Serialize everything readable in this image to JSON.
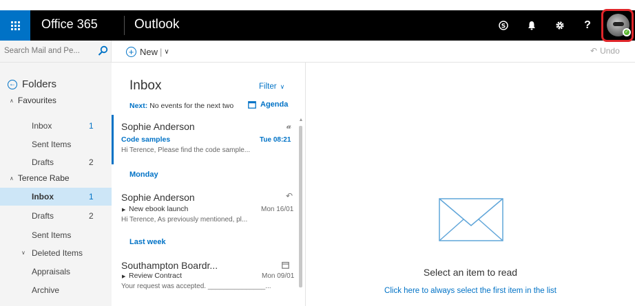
{
  "topbar": {
    "brand": "Office 365",
    "app": "Outlook",
    "icons": [
      "skype-icon",
      "bell-icon",
      "gear-icon",
      "help-icon"
    ],
    "help_label": "?"
  },
  "command": {
    "search_placeholder": "Search Mail and Pe...",
    "new_label": "New",
    "undo_label": "Undo"
  },
  "folders": {
    "heading": "Folders",
    "favourites": {
      "label": "Favourites",
      "items": [
        {
          "label": "Inbox",
          "count": "1"
        },
        {
          "label": "Sent Items",
          "count": ""
        },
        {
          "label": "Drafts",
          "count": "2"
        }
      ]
    },
    "account": {
      "label": "Terence Rabe",
      "items": [
        {
          "label": "Inbox",
          "count": "1"
        },
        {
          "label": "Drafts",
          "count": "2"
        },
        {
          "label": "Sent Items",
          "count": ""
        },
        {
          "label": "Deleted Items",
          "count": ""
        },
        {
          "label": "Appraisals",
          "count": ""
        },
        {
          "label": "Archive",
          "count": ""
        }
      ]
    }
  },
  "list": {
    "title": "Inbox",
    "filter_label": "Filter",
    "next_label": "Next:",
    "next_text": "No events for the next two",
    "agenda_label": "Agenda",
    "groups": [
      "Monday",
      "Last week"
    ],
    "messages": [
      {
        "sender": "Sophie Anderson",
        "subject": "Code samples",
        "date": "Tue 08:21",
        "preview": "Hi Terence,  Please find the code sample..."
      },
      {
        "sender": "Sophie Anderson",
        "subject": "New ebook launch",
        "date": "Mon 16/01",
        "preview": "Hi Terence,  As previously mentioned, pl..."
      },
      {
        "sender": "Southampton Boardr...",
        "subject": "Review Contract",
        "date": "Mon 09/01",
        "preview": "Your request was accepted. _______________..."
      }
    ]
  },
  "reading": {
    "title": "Select an item to read",
    "link": "Click here to always select the first item in the list"
  },
  "colors": {
    "accent": "#0072c6",
    "topbar": "#000000",
    "selected": "#cde6f7",
    "highlight": "#e0262a"
  }
}
